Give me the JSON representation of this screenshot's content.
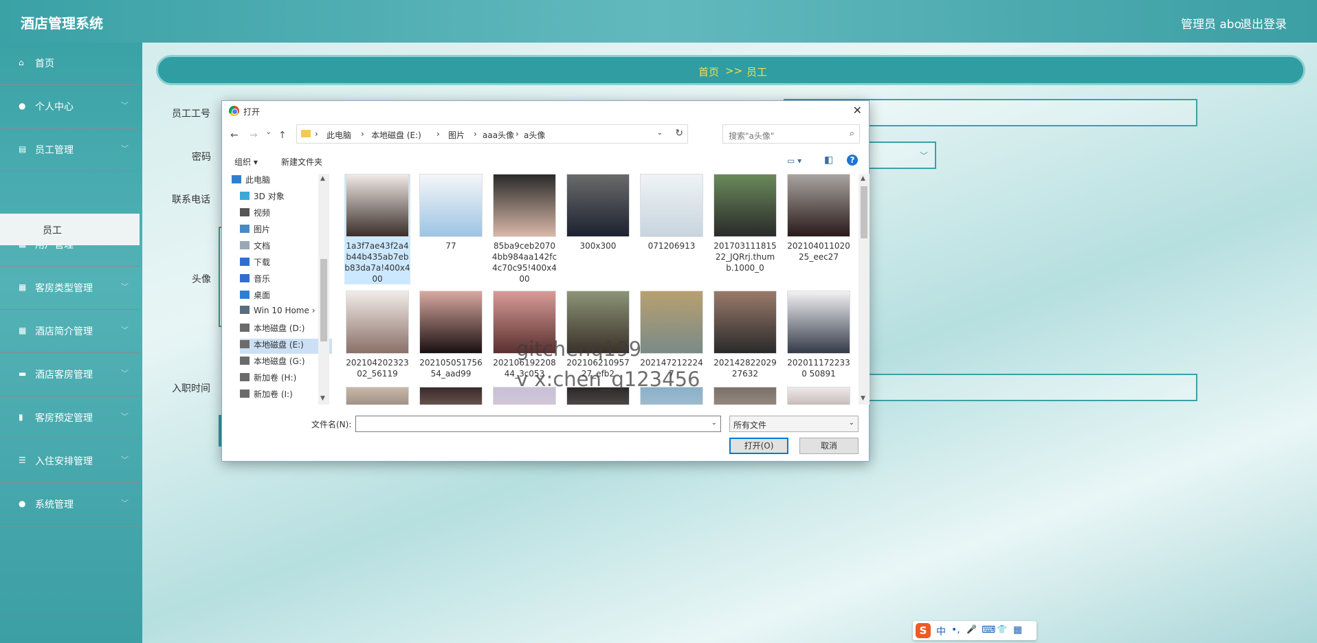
{
  "app": {
    "title": "酒店管理系统",
    "admin_label": "管理员 abo",
    "logout": "退出登录"
  },
  "sidebar": {
    "items": [
      {
        "label": "首页",
        "icon": "home-icon",
        "glyph": "⌂"
      },
      {
        "label": "个人中心",
        "icon": "user-icon",
        "glyph": "●"
      },
      {
        "label": "员工管理",
        "icon": "building-icon",
        "glyph": "▤"
      },
      {
        "label": "用户管理",
        "icon": "grid-icon",
        "glyph": "▦"
      },
      {
        "label": "客房类型管理",
        "icon": "grid-icon",
        "glyph": "▦"
      },
      {
        "label": "酒店简介管理",
        "icon": "grid-icon",
        "glyph": "▦"
      },
      {
        "label": "酒店客房管理",
        "icon": "comment-icon",
        "glyph": "▬"
      },
      {
        "label": "客房预定管理",
        "icon": "bar-chart-icon",
        "glyph": "▮"
      },
      {
        "label": "入住安排管理",
        "icon": "sliders-icon",
        "glyph": "☰"
      },
      {
        "label": "系统管理",
        "icon": "user-icon",
        "glyph": "●"
      }
    ],
    "submenu": "员工",
    "chevron": "﹀"
  },
  "breadcrumb": {
    "home": "首页",
    "sep": ">>",
    "current": "员工"
  },
  "form": {
    "labels": {
      "staff_id": "员工工号",
      "password": "密码",
      "phone": "联系电话",
      "avatar": "头像",
      "hire_date": "入职时间"
    }
  },
  "dialog": {
    "title": "打开",
    "close": "✕",
    "nav": {
      "back": "←",
      "forward": "→",
      "recent": "⌄",
      "up": "↑"
    },
    "path": [
      "此电脑",
      "本地磁盘 (E:)",
      "图片",
      "aaa头像",
      "a头像"
    ],
    "path_sep": "›",
    "refresh": "↻",
    "search_placeholder": "搜索\"a头像\"",
    "search_icon": "⌕",
    "toolbar": {
      "organize": "组织 ▾",
      "new_folder": "新建文件夹",
      "view": "▭ ▾",
      "pane": "◧",
      "help": "?"
    },
    "nav_pane": [
      {
        "label": "此电脑",
        "icon": "computer-icon",
        "color": "#2f7fd0"
      },
      {
        "label": "3D 对象",
        "icon": "3d-objects-icon",
        "color": "#3aa9d8"
      },
      {
        "label": "视频",
        "icon": "video-icon",
        "color": "#555"
      },
      {
        "label": "图片",
        "icon": "pictures-icon",
        "color": "#4a8ac4"
      },
      {
        "label": "文档",
        "icon": "documents-icon",
        "color": "#9aa7b4"
      },
      {
        "label": "下载",
        "icon": "download-icon",
        "color": "#2e6fd1"
      },
      {
        "label": "音乐",
        "icon": "music-icon",
        "color": "#2e6fd1"
      },
      {
        "label": "桌面",
        "icon": "desktop-icon",
        "color": "#2f7fd0"
      },
      {
        "label": "Win 10 Home ›",
        "icon": "drive-icon",
        "color": "#5a6d80"
      },
      {
        "label": "本地磁盘 (D:)",
        "icon": "drive-icon",
        "color": "#6b6b6b"
      },
      {
        "label": "本地磁盘 (E:)",
        "icon": "drive-icon",
        "color": "#6b6b6b"
      },
      {
        "label": "本地磁盘 (G:)",
        "icon": "drive-icon",
        "color": "#6b6b6b"
      },
      {
        "label": "新加卷 (H:)",
        "icon": "drive-icon",
        "color": "#6b6b6b"
      },
      {
        "label": "新加卷 (I:)",
        "icon": "drive-icon",
        "color": "#6b6b6b"
      }
    ],
    "selected_nav": 10,
    "files": [
      {
        "name": "1a3f7ae43f2a4b44b435ab7ebb83da7a!400x400",
        "c1": "#f1e9e6",
        "c2": "#3a2e2a"
      },
      {
        "name": "77",
        "c1": "#f5f6f8",
        "c2": "#9cc4e4"
      },
      {
        "name": "85ba9ceb20704bb984aa142fc4c70c95!400x400",
        "c1": "#2a2a2a",
        "c2": "#d9b8a8"
      },
      {
        "name": "300x300",
        "c1": "#6a6a6a",
        "c2": "#1c2230"
      },
      {
        "name": "071206913",
        "c1": "#eef3f6",
        "c2": "#c8d4de"
      },
      {
        "name": "20170311181522_JQRrj.thumb.1000_0",
        "c1": "#6a8a5a",
        "c2": "#2a2a2a"
      },
      {
        "name": "20210401102025_eec27",
        "c1": "#a8a4a0",
        "c2": "#2a1a1a"
      },
      {
        "name": "20210420232302_56119",
        "c1": "#f2ece8",
        "c2": "#8a7068"
      },
      {
        "name": "20210505175654_aad99",
        "c1": "#d8a8a0",
        "c2": "#1a1010"
      },
      {
        "name": "20210619220844_3c053",
        "c1": "#d89c98",
        "c2": "#5a3030"
      },
      {
        "name": "20210621095727_efb2",
        "c1": "#8c9478",
        "c2": "#3a3028"
      },
      {
        "name": "2021472122247",
        "c1": "#b8a070",
        "c2": "#7a8a88"
      },
      {
        "name": "20214282202927632",
        "c1": "#9a7a6a",
        "c2": "#2a2a2a"
      },
      {
        "name": "2020111722330 50891",
        "c1": "#f2f2f4",
        "c2": "#343a48"
      },
      {
        "name": "",
        "c1": "#c8b8a8",
        "c2": "#3a3030"
      },
      {
        "name": "",
        "c1": "#3a2a2a",
        "c2": "#d8b8a8"
      },
      {
        "name": "",
        "c1": "#c8c0d8",
        "c2": "#e8d8d0"
      },
      {
        "name": "",
        "c1": "#2a2828",
        "c2": "#a89890"
      },
      {
        "name": "",
        "c1": "#8ab0c8",
        "c2": "#d0d8e0"
      },
      {
        "name": "",
        "c1": "#7a7068",
        "c2": "#d8c8b8"
      },
      {
        "name": "",
        "c1": "#f0e8e8",
        "c2": "#5a4a48"
      }
    ],
    "watermark": {
      "line1": "gitchenq199",
      "line2": "v x:chen_q123456"
    },
    "filename_label": "文件名(N):",
    "filename_value": "",
    "filetype": "所有文件",
    "open_btn": "打开(O)",
    "cancel_btn": "取消"
  },
  "ime": {
    "logo": "S",
    "items": [
      "中",
      "•,",
      "🎤",
      "⌨",
      "👕",
      "▦"
    ]
  }
}
